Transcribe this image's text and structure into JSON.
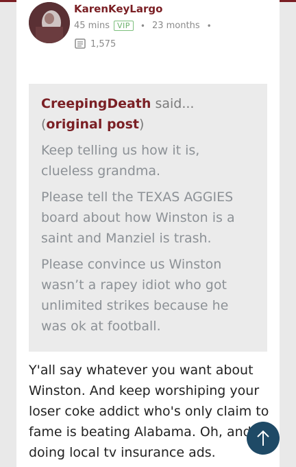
{
  "post": {
    "username": "KarenKeyLargo",
    "time_ago": "45 mins",
    "badge": "VIP",
    "member_since": "23 months",
    "post_count": "1,575"
  },
  "quote": {
    "author": "CreepingDeath",
    "said": " said... (",
    "link": "original post",
    "close": ")",
    "paragraphs": [
      "Keep telling us how it is, clueless grandma.",
      "Please tell the TEXAS AGGIES board about how Winston is a saint and Manziel is trash.",
      "Please convince us Winston wasn’t a rapey idiot who got unlimited strikes because he was ok at football."
    ]
  },
  "reply": {
    "text": "Y'all say whatever you want about Winston. And keep worshiping your loser coke addict who's only claim to fame is beating Alabama. Oh, and doing local tv insurance ads."
  },
  "colors": {
    "brand": "#7a1f24",
    "vip": "#6ab06a",
    "quote_bg": "#ebebeb",
    "scroll_button": "#1f4a66"
  },
  "icons": {
    "posts": "posts-icon",
    "scroll_top": "arrow-up-icon"
  }
}
